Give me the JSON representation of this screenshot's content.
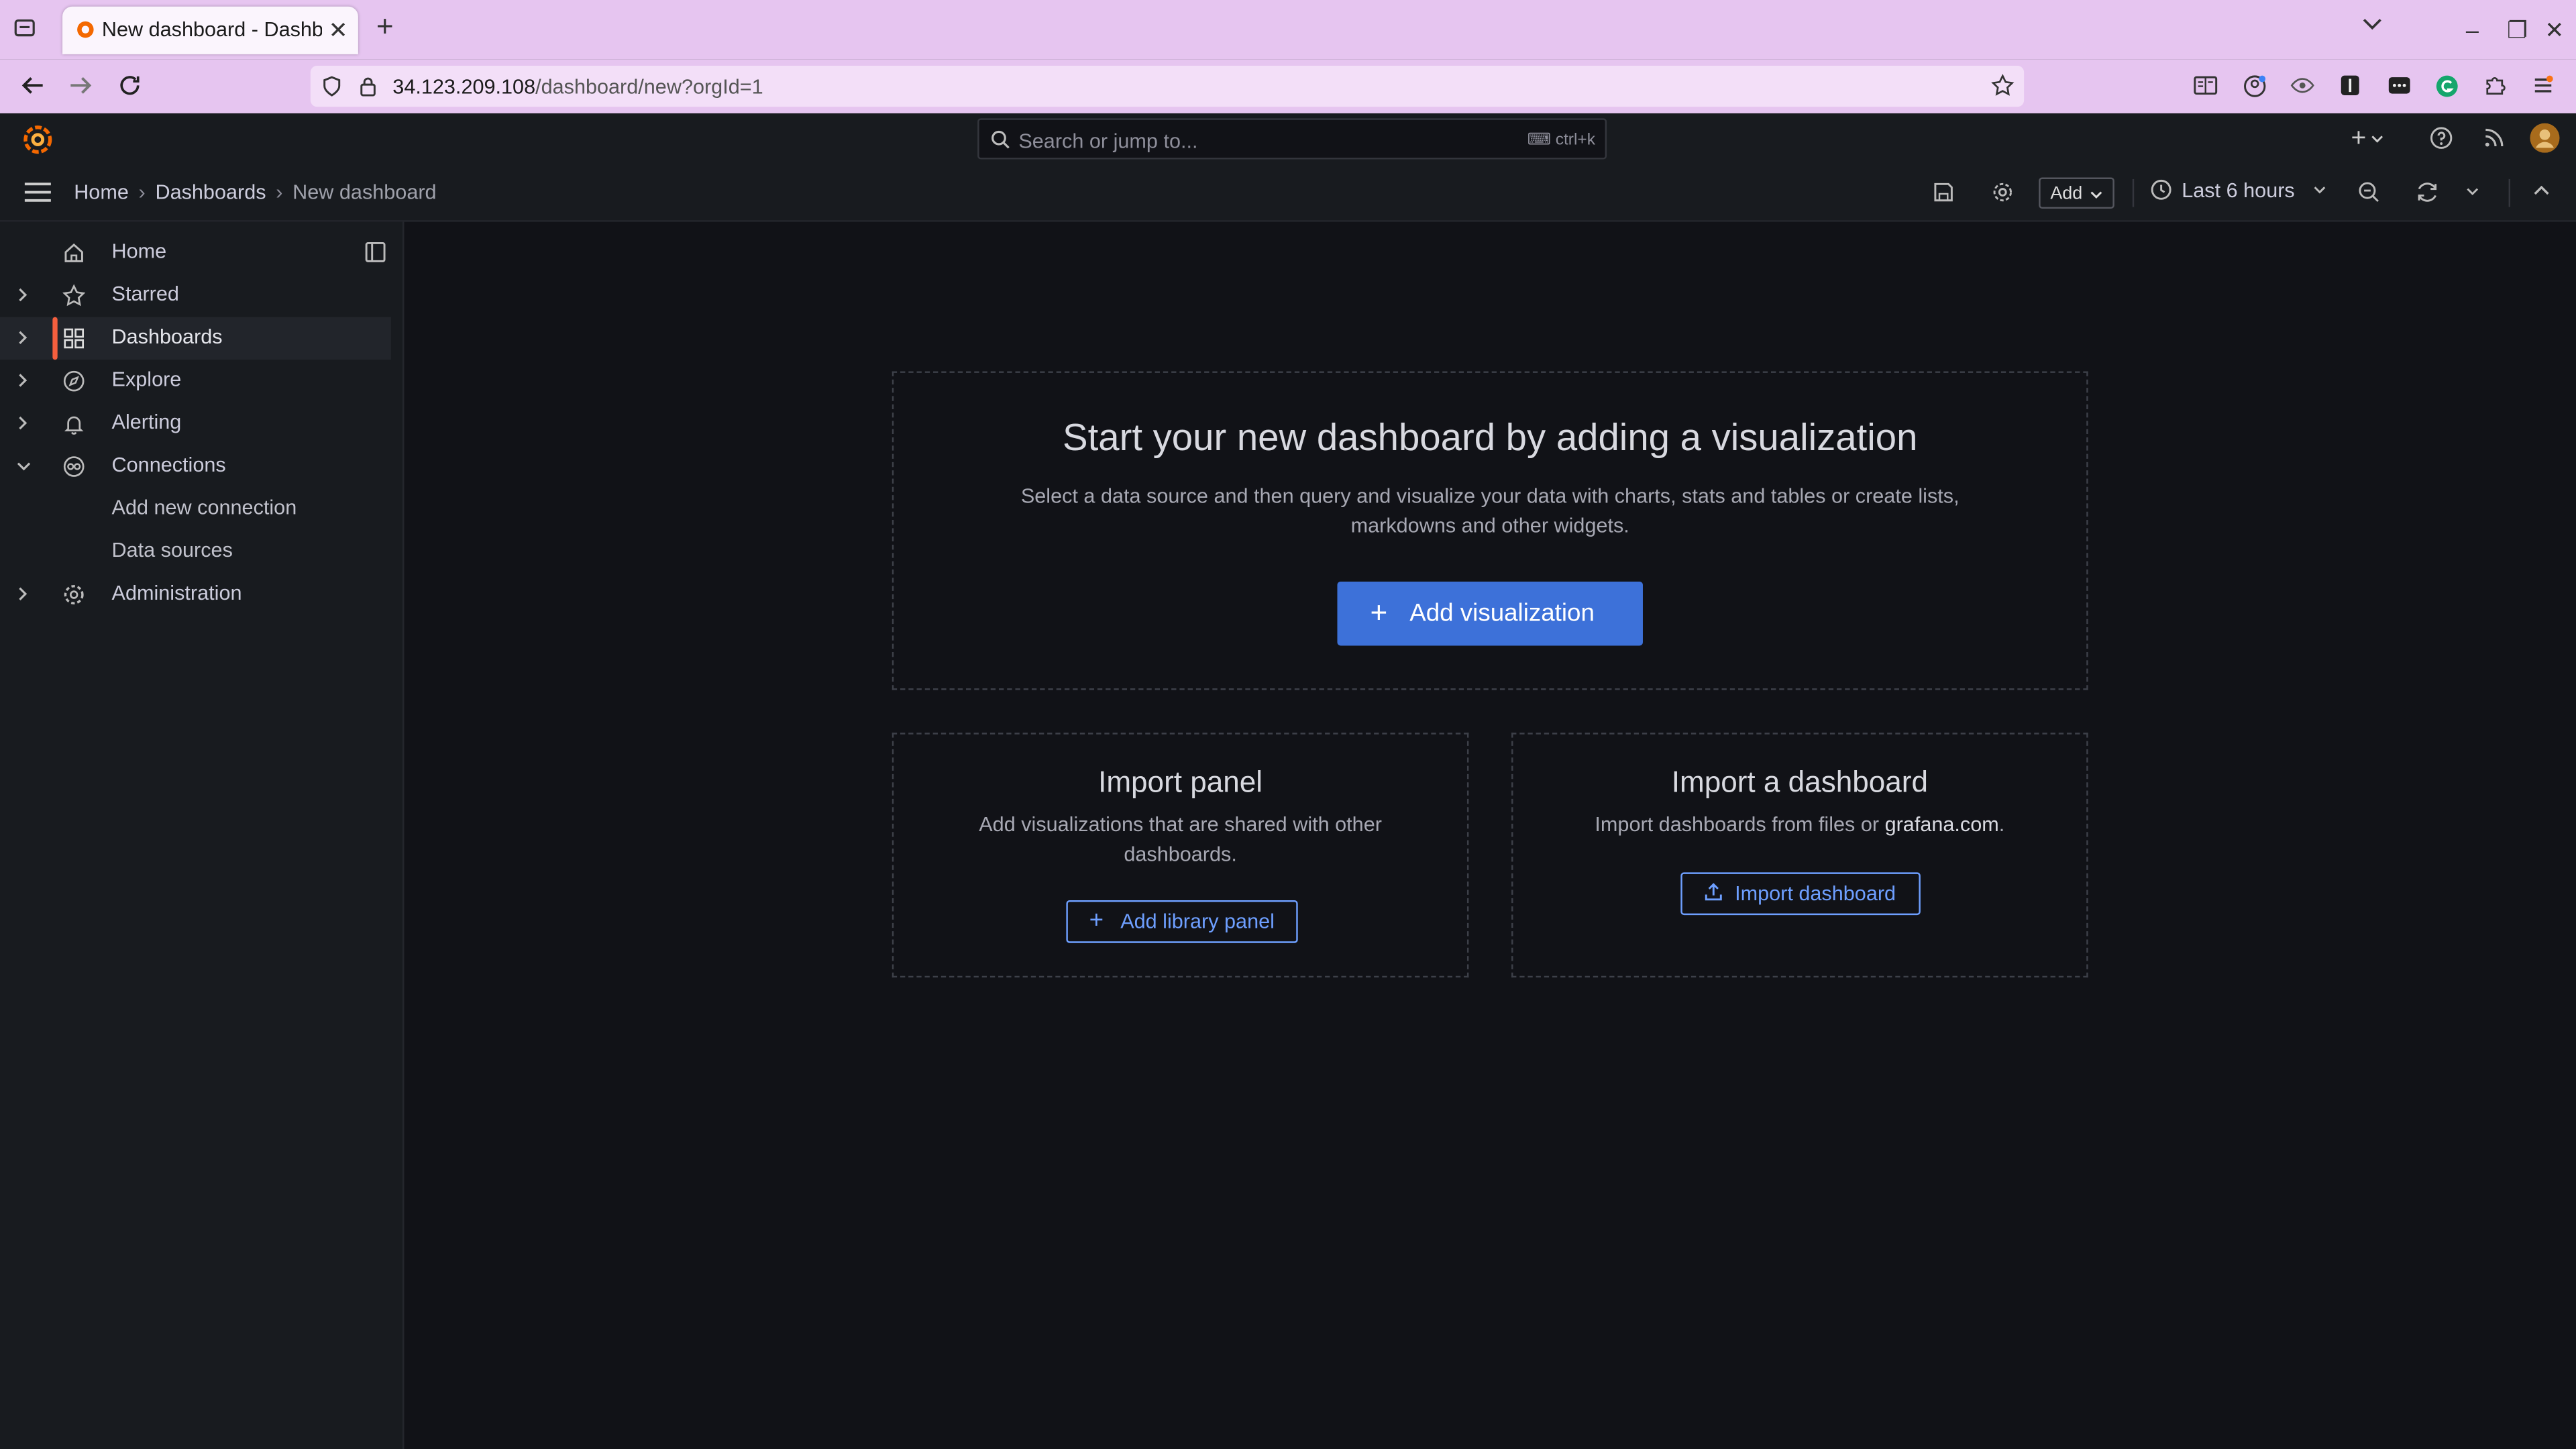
{
  "browser": {
    "tab_title": "New dashboard - Dashbo",
    "url_host": "34.123.209.108",
    "url_path": "/dashboard/new?orgId=1"
  },
  "grafana": {
    "search_placeholder": "Search or jump to...",
    "search_shortcut": "ctrl+k",
    "breadcrumbs": [
      "Home",
      "Dashboards",
      "New dashboard"
    ],
    "add_label": "Add",
    "time_range": "Last 6 hours"
  },
  "sidebar": {
    "items": [
      {
        "label": "Home",
        "icon": "home-icon"
      },
      {
        "label": "Starred",
        "icon": "star-icon"
      },
      {
        "label": "Dashboards",
        "icon": "apps-icon",
        "active": true
      },
      {
        "label": "Explore",
        "icon": "compass-icon"
      },
      {
        "label": "Alerting",
        "icon": "bell-icon"
      },
      {
        "label": "Connections",
        "icon": "connections-icon",
        "expanded": true
      },
      {
        "label": "Add new connection"
      },
      {
        "label": "Data sources"
      },
      {
        "label": "Administration",
        "icon": "cog-icon"
      }
    ]
  },
  "main": {
    "hero": {
      "title": "Start your new dashboard by adding a visualization",
      "desc_line1": "Select a data source and then query and visualize your data with charts, stats and tables or create lists,",
      "desc_line2": "markdowns and other widgets.",
      "button": "Add visualization"
    },
    "import_panel": {
      "title": "Import panel",
      "desc_line1": "Add visualizations that are shared with other",
      "desc_line2": "dashboards.",
      "button": "Add library panel"
    },
    "import_dashboard": {
      "title": "Import a dashboard",
      "desc_prefix": "Import dashboards from files or ",
      "desc_link": "grafana.com",
      "desc_suffix": ".",
      "button": "Import dashboard"
    }
  },
  "colors": {
    "accent": "#3d71d9",
    "active_marker": "#f55f3e",
    "background": "#111217",
    "browser_chrome": "#e6c5f0"
  }
}
